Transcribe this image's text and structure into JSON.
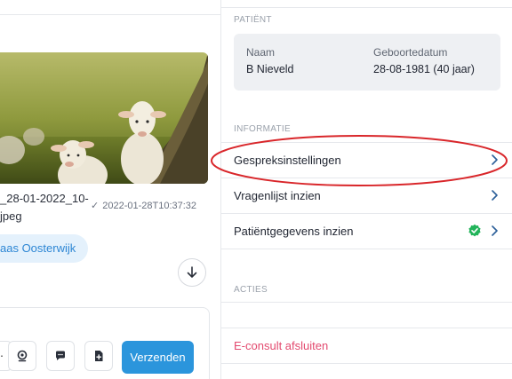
{
  "chat": {
    "filename_line1": "_28-01-2022_10-",
    "filename_line2": "jpeg",
    "timestamp": "2022-01-28T10:37:32",
    "sender_chip": "aas Oosterwijk",
    "send_label": "Verzenden",
    "tools": [
      "webcam-icon",
      "chat-bubble-icon",
      "file-add-icon"
    ]
  },
  "sidebar": {
    "patient_section": "PATIËNT",
    "patient": {
      "name_label": "Naam",
      "name_value": "B Nieveld",
      "dob_label": "Geboortedatum",
      "dob_value": "28-08-1981 (40 jaar)"
    },
    "info_section": "INFORMATIE",
    "info_items": [
      {
        "label": "Gespreksinstellingen"
      },
      {
        "label": "Vragenlijst inzien"
      },
      {
        "label": "Patiëntgegevens inzien",
        "status": "complete"
      }
    ],
    "actions_section": "ACTIES",
    "actions": [
      {
        "label": ""
      },
      {
        "label": "E-consult afsluiten",
        "color": "#e34a6f"
      }
    ]
  },
  "colors": {
    "accent": "#2b95dc",
    "chip_bg": "#e4f1fc",
    "success": "#22b45a",
    "danger": "#e34a6f",
    "annotation": "#d9262a"
  }
}
